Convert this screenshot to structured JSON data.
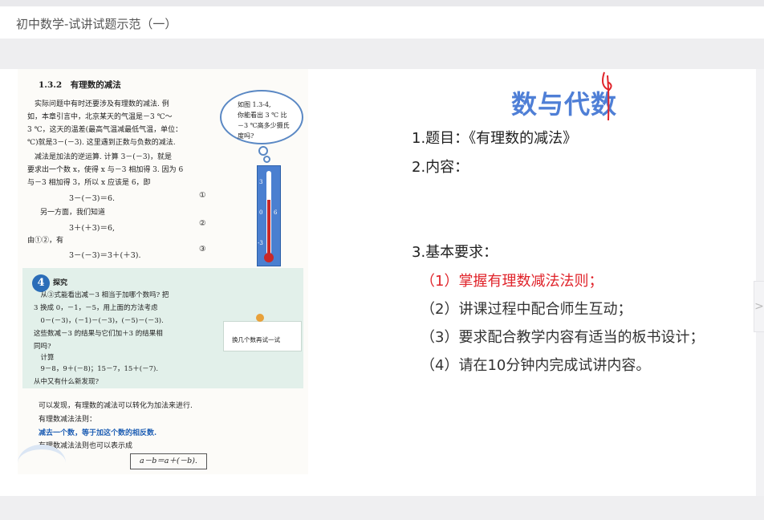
{
  "page_title": "初中数学-试讲试题示范（一）",
  "nav": {
    "next_arrow": ">"
  },
  "textbook": {
    "section_title": "1.3.2　有理数的减法",
    "lines": [
      "　实际问题中有时还要涉及有理数的减法. 例",
      "如，本章引言中，北京某天的气温是－3 ℃～",
      "3 ℃，这天的温差(最高气温减最低气温，单位：",
      "℃)就是3－(－3). 这里遇到正数与负数的减法.",
      "　减法是加法的逆运算. 计算 3－(－3)，就是",
      "要求出一个数 x，使得 x 与－3 相加得 3. 因为 6",
      "与－3 相加得 3，所以 x 应该是 6，即"
    ],
    "eq1": "3－(－3)＝6.",
    "eq1_num": "①",
    "line_other": "另一方面，我们知道",
    "eq2": "3＋(＋3)＝6,",
    "eq2_num": "②",
    "line_from": "由①②，有",
    "eq3": "3－(－3)＝3＋(＋3).",
    "eq3_num": "③",
    "bubble_lines": [
      "如图 1.3-4,",
      "你能看出 3 ℃ 比",
      "－3 ℃高多少摄氏",
      "度吗?"
    ],
    "thermo_labels": [
      "3",
      "0",
      "-3",
      "6"
    ],
    "explore_title": "探究",
    "explore_lines": [
      "　从③式能看出减－3 相当于加哪个数吗? 把",
      "3 换成 0，－1，－5，用上面的方法考虑",
      "　0－(－3)，(－1)－(－3)，(－5)－(－3).",
      "这些数减－3 的结果与它们加＋3 的结果相",
      "同吗?",
      "　计算",
      "　9－8，9＋(－8)；15－7，15＋(－7).",
      "从中又有什么新发现?"
    ],
    "hint_text": "换几个数再试一试",
    "tail_lines": [
      "可以发现，有理数的减法可以转化为加法来进行.",
      "有理数减法法则："
    ],
    "rule_text": "减去一个数，等于加这个数的相反数.",
    "rule_expr_intro": "有理数减法法则也可以表示成",
    "formula": "a－b＝a＋(－b)."
  },
  "slide": {
    "heading": "数与代数",
    "items": [
      "1.题目：《有理数的减法》",
      "2.内容：",
      "3.基本要求："
    ],
    "requirements": [
      "（1）掌握有理数减法法则；",
      "（2）讲课过程中配合师生互动；",
      "（3）要求配合教学内容有适当的板书设计；",
      "（4）请在10分钟内完成试讲内容。"
    ]
  },
  "colors": {
    "heading": "#4f7fd6",
    "requirement_highlight": "#e0242b",
    "explore_bg": "#e2f0ea",
    "rule_blue": "#1f5fb4"
  }
}
